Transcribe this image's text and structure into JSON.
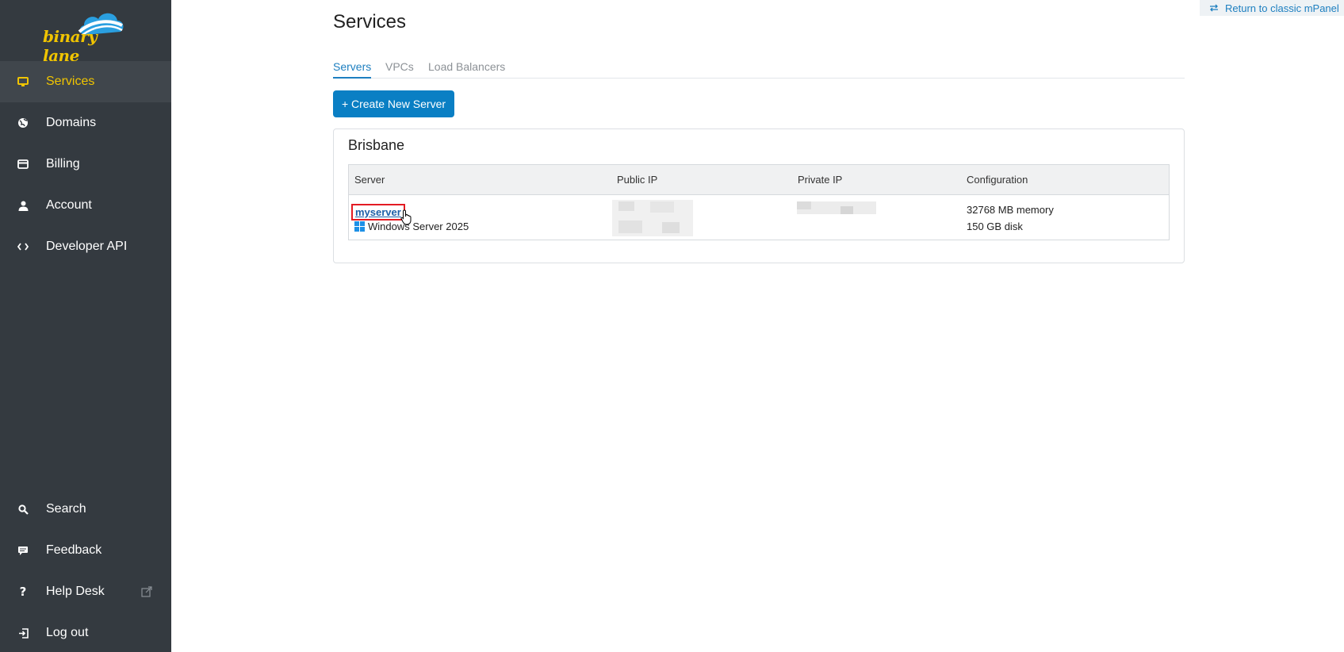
{
  "brand": {
    "logo_text": "binary lane",
    "accent": "#f0c400",
    "sidebar_bg": "#343a40"
  },
  "top_link": {
    "label": "Return to classic mPanel",
    "icon": "swap-arrows-icon"
  },
  "sidebar": {
    "items": [
      {
        "label": "Services",
        "icon": "monitor-icon",
        "active": true
      },
      {
        "label": "Domains",
        "icon": "globe-icon"
      },
      {
        "label": "Billing",
        "icon": "credit-card-icon"
      },
      {
        "label": "Account",
        "icon": "person-icon"
      },
      {
        "label": "Developer API",
        "icon": "code-icon"
      }
    ],
    "bottom_items": [
      {
        "label": "Search",
        "icon": "search-icon"
      },
      {
        "label": "Feedback",
        "icon": "chat-icon"
      },
      {
        "label": "Help Desk",
        "icon": "question-icon",
        "external_icon": "external-link-icon"
      },
      {
        "label": "Log out",
        "icon": "logout-icon"
      }
    ]
  },
  "main": {
    "title": "Services",
    "tabs": [
      {
        "label": "Servers",
        "active": true
      },
      {
        "label": "VPCs"
      },
      {
        "label": "Load Balancers"
      }
    ],
    "create_button": "+ Create New Server",
    "region": {
      "name": "Brisbane",
      "columns": [
        "Server",
        "Public IP",
        "Private IP",
        "Configuration"
      ],
      "rows": [
        {
          "server": "myserver",
          "os": "Windows Server 2025",
          "memory": "32768 MB memory",
          "disk": "150 GB disk"
        }
      ]
    }
  },
  "colors": {
    "link": "#1d7fc0",
    "button": "#0a7fc4",
    "highlight": "#e31b23"
  }
}
